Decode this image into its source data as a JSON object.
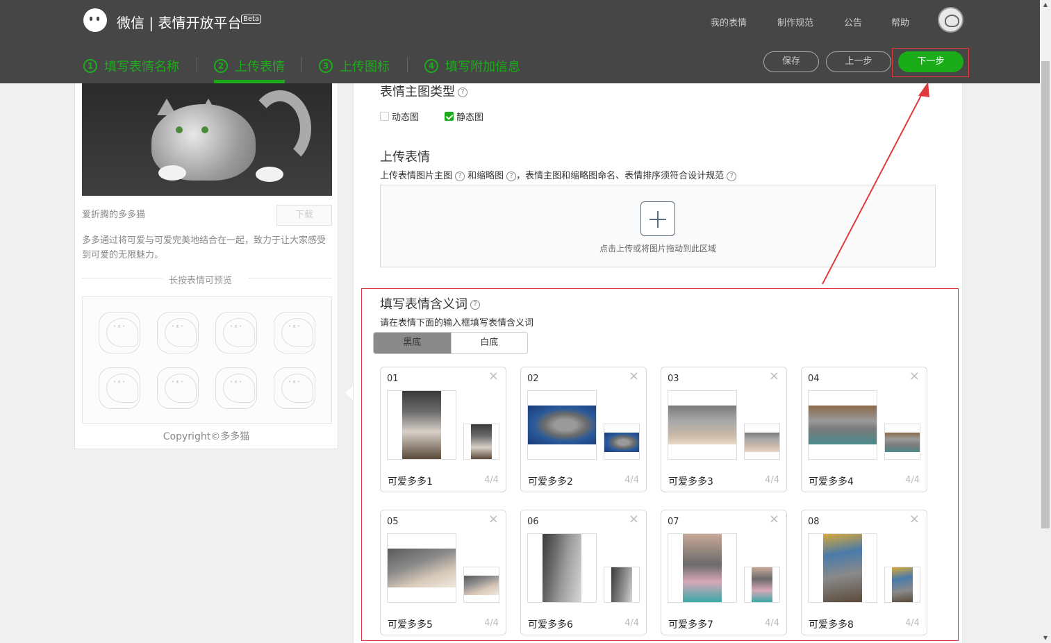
{
  "header": {
    "brand": "微信 | 表情开放平台",
    "beta": "Beta",
    "nav": [
      "我的表情",
      "制作规范",
      "公告",
      "帮助"
    ],
    "steps": [
      {
        "num": "1",
        "label": "填写表情名称"
      },
      {
        "num": "2",
        "label": "上传表情"
      },
      {
        "num": "3",
        "label": "上传图标"
      },
      {
        "num": "4",
        "label": "填写附加信息"
      }
    ],
    "buttons": {
      "save": "保存",
      "prev": "上一步",
      "next": "下一步"
    },
    "accent": "#1aad19"
  },
  "preview": {
    "name": "爱折腾的多多猫",
    "download": "下载",
    "description": "多多通过将可爱与可爱完美地结合在一起，致力于让大家感受到可爱的无限魅力。",
    "hint": "长按表情可预览",
    "copyright": "Copyright©多多猫"
  },
  "main": {
    "type_title": "表情主图类型",
    "type_options": [
      {
        "label": "动态图",
        "checked": false
      },
      {
        "label": "静态图",
        "checked": true
      }
    ],
    "upload_title": "上传表情",
    "upload_desc": {
      "part1": "上传表情图片主图",
      "part2": "和缩略图",
      "part3": "，表情主图和缩略图命名、表情排序须符合设计规范"
    },
    "dropzone_text": "点击上传或将图片拖动到此区域",
    "meaning_title": "填写表情含义词",
    "meaning_desc": "请在表情下面的输入框填写表情含义词",
    "bg_toggle": {
      "dark": "黑底",
      "light": "白底"
    },
    "help_glyph": "?",
    "close_glyph": "×",
    "stickers": [
      {
        "num": "01",
        "meaning": "可爱多多1",
        "count": "4/4"
      },
      {
        "num": "02",
        "meaning": "可爱多多2",
        "count": "4/4"
      },
      {
        "num": "03",
        "meaning": "可爱多多3",
        "count": "4/4"
      },
      {
        "num": "04",
        "meaning": "可爱多多4",
        "count": "4/4"
      },
      {
        "num": "05",
        "meaning": "可爱多多5",
        "count": "4/4"
      },
      {
        "num": "06",
        "meaning": "可爱多多6",
        "count": "4/4"
      },
      {
        "num": "07",
        "meaning": "可爱多多7",
        "count": "4/4"
      },
      {
        "num": "08",
        "meaning": "可爱多多8",
        "count": "4/4"
      }
    ]
  }
}
